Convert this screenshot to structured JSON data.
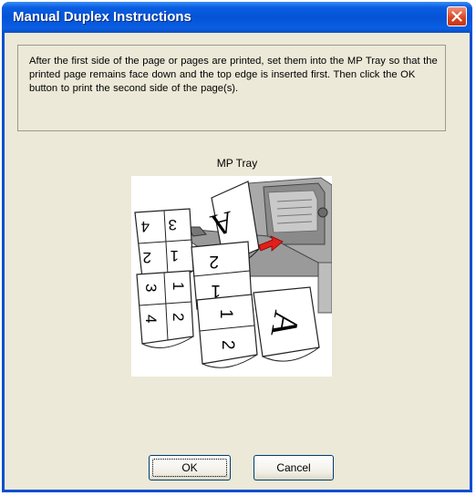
{
  "window": {
    "title": "Manual Duplex Instructions",
    "close_icon": "close-icon"
  },
  "instructions": {
    "text": "After the first side of the page or pages are printed, set them into the MP Tray so that the printed page remains face down and the top edge is inserted first. Then click the OK button to print the second side of the page(s)."
  },
  "illustration": {
    "label": "MP Tray",
    "pages": {
      "top_page_letter": "A",
      "stack1": [
        "4",
        "3",
        "2",
        "1"
      ],
      "stack2": [
        "2",
        "1"
      ],
      "stack3": [
        "3",
        "1",
        "4",
        "2"
      ],
      "stack4": [
        "1",
        "2"
      ],
      "stack5_letter": "A"
    }
  },
  "buttons": {
    "ok": "OK",
    "cancel": "Cancel"
  },
  "colors": {
    "titlebar": "#0553d6",
    "dialog_bg": "#ece9d8",
    "close_button": "#d9431f",
    "arrow": "#e0201a"
  }
}
